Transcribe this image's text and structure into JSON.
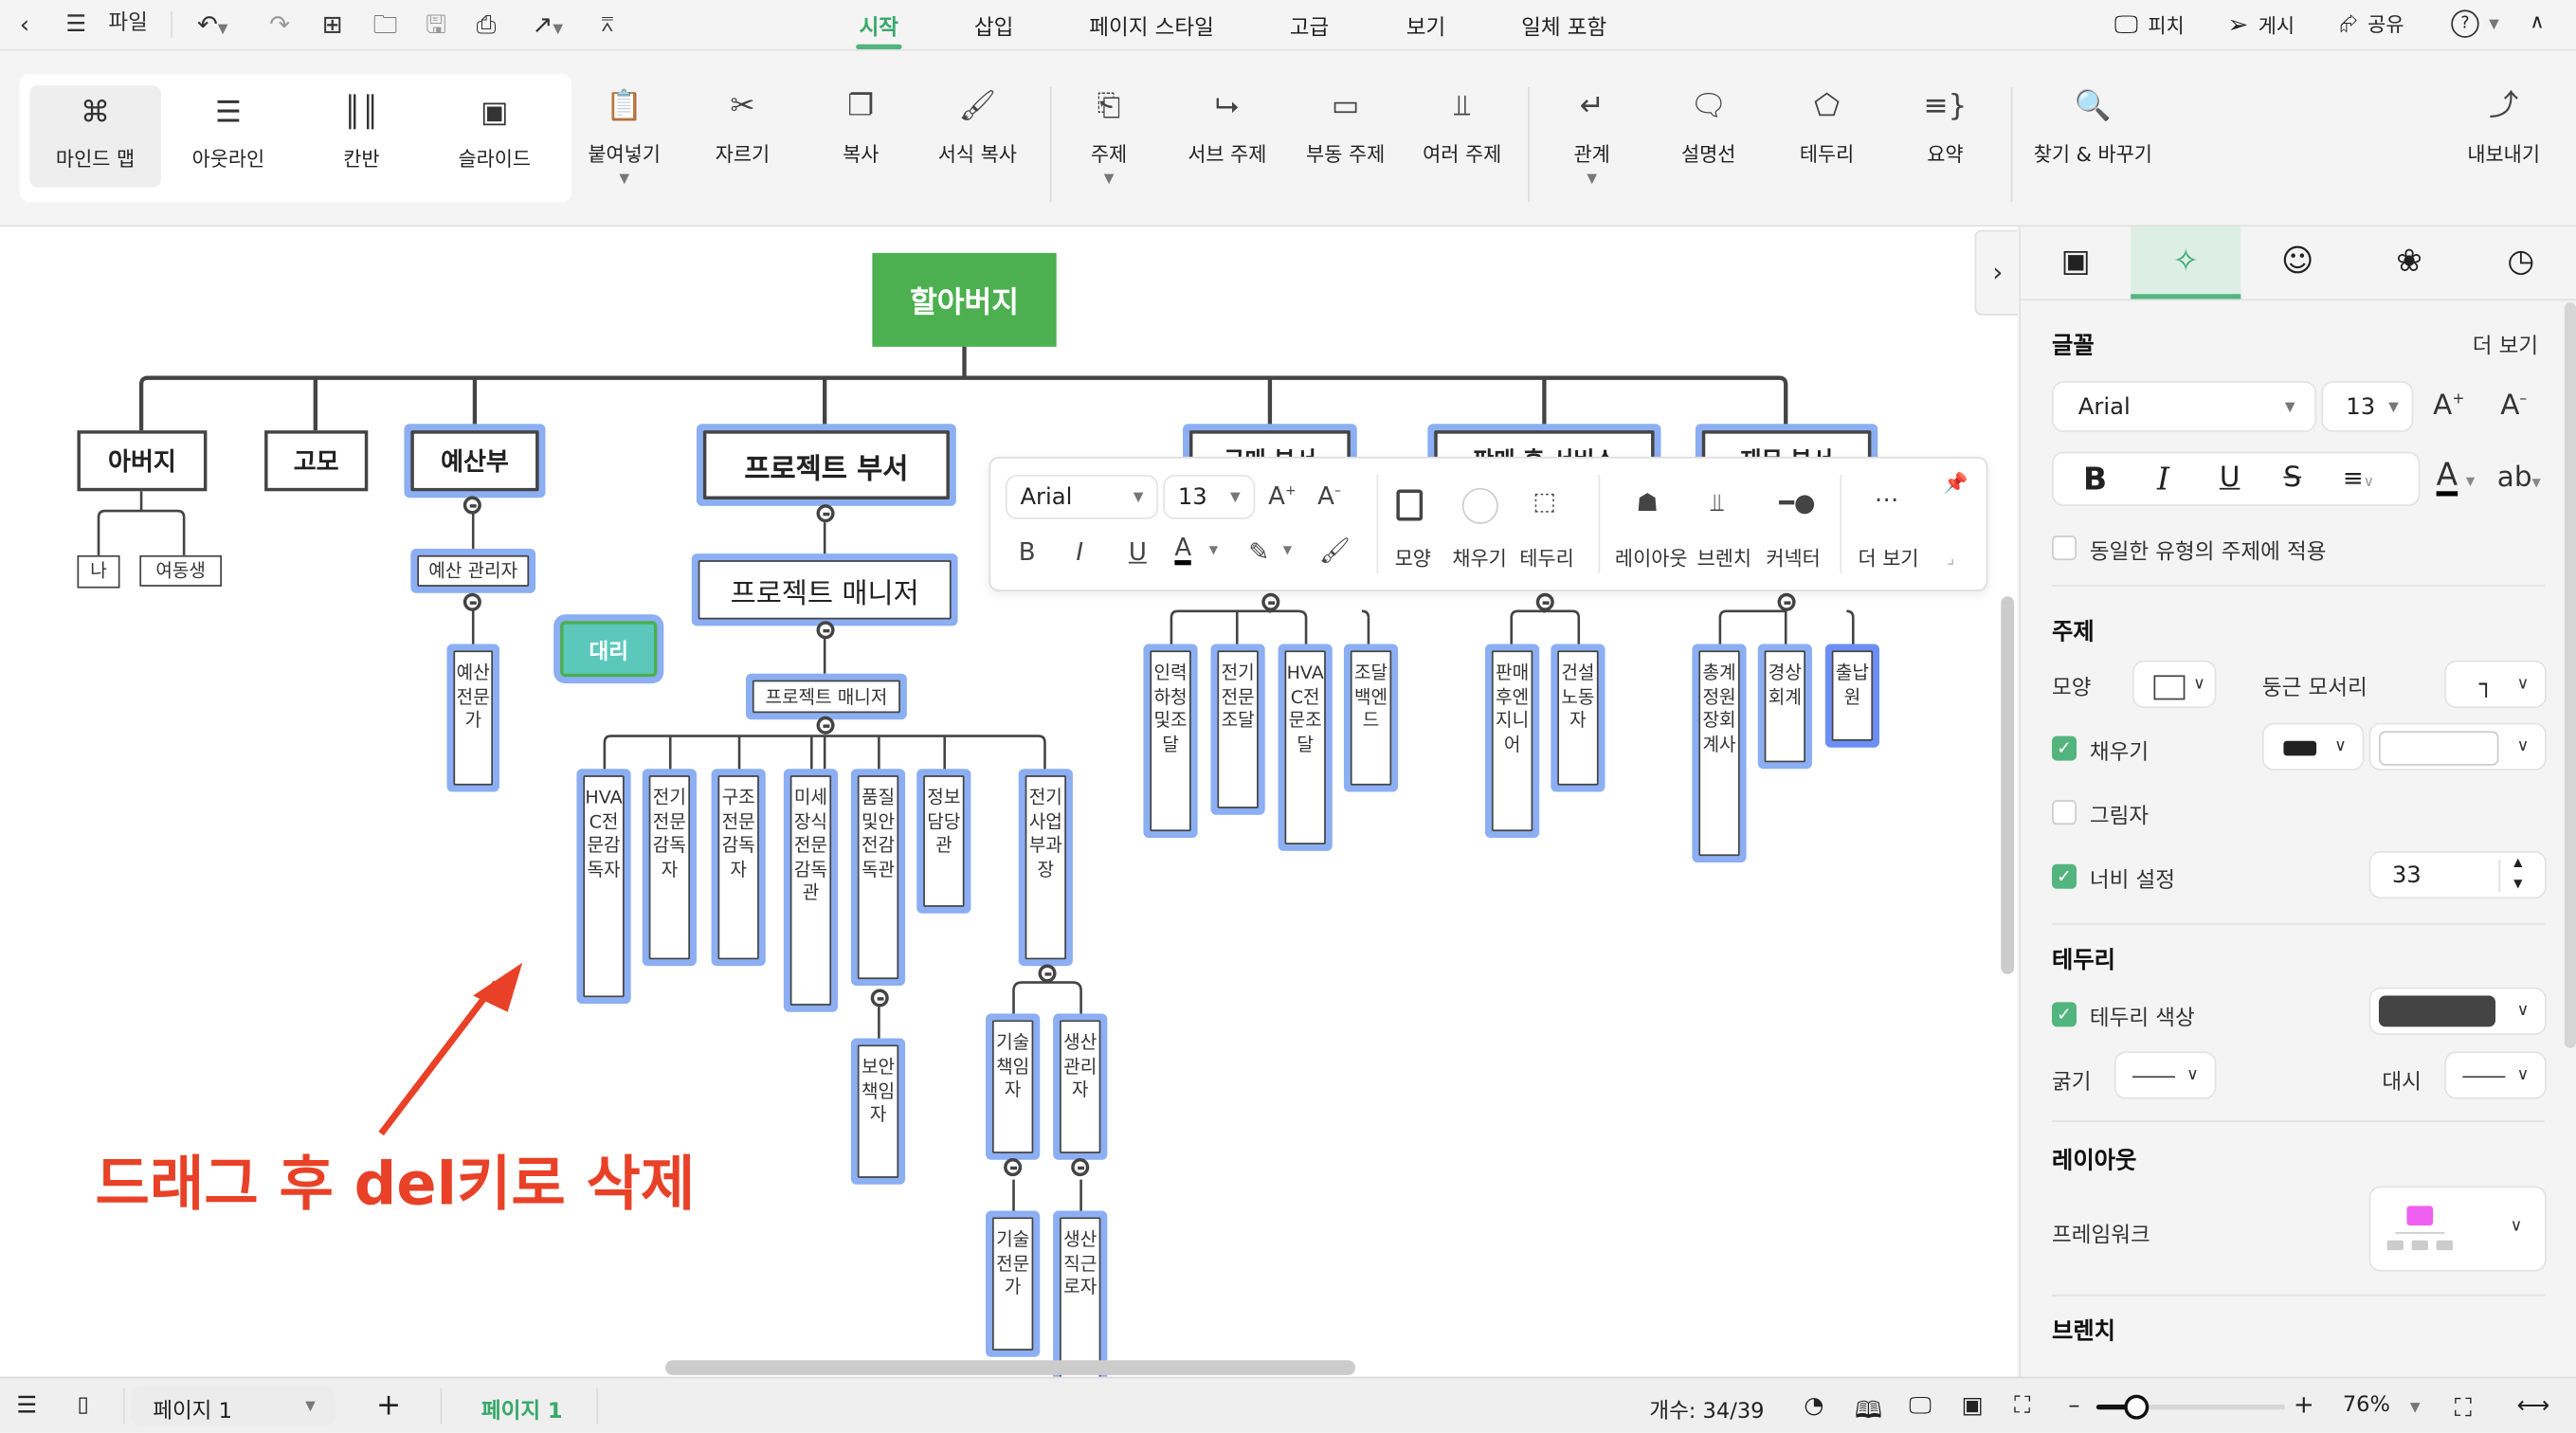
{
  "titlebar": {
    "back_icon": "chevron-left-icon",
    "menu_icon": "hamburger-icon",
    "file_label": "파일",
    "quick_icons": [
      "undo-icon",
      "redo-icon",
      "new-icon",
      "open-folder-icon",
      "save-icon",
      "print-icon",
      "export-icon",
      "customize-icon"
    ]
  },
  "menu_tabs": [
    {
      "label": "시작",
      "active": true
    },
    {
      "label": "삽입"
    },
    {
      "label": "페이지 스타일"
    },
    {
      "label": "고급"
    },
    {
      "label": "보기"
    },
    {
      "label": "일체 포함"
    }
  ],
  "top_right": {
    "pitch": "피치",
    "publish": "게시",
    "share": "공유"
  },
  "ribbon": {
    "views": [
      {
        "label": "마인드 맵",
        "icon": "mindmap-icon",
        "active": true
      },
      {
        "label": "아웃라인",
        "icon": "outline-icon"
      },
      {
        "label": "칸반",
        "icon": "kanban-icon"
      },
      {
        "label": "슬라이드",
        "icon": "slide-icon"
      }
    ],
    "buttons": [
      {
        "label": "붙여넣기",
        "icon": "paste-icon",
        "dropdown": true
      },
      {
        "label": "자르기",
        "icon": "cut-icon"
      },
      {
        "label": "복사",
        "icon": "copy-icon"
      },
      {
        "label": "서식 복사",
        "icon": "format-painter-icon"
      },
      {
        "label": "주제",
        "icon": "topic-icon",
        "dropdown": true
      },
      {
        "label": "서브 주제",
        "icon": "subtopic-icon"
      },
      {
        "label": "부동 주제",
        "icon": "floating-topic-icon"
      },
      {
        "label": "여러 주제",
        "icon": "multiple-topics-icon"
      },
      {
        "label": "관계",
        "icon": "relationship-icon",
        "dropdown": true
      },
      {
        "label": "설명선",
        "icon": "callout-icon"
      },
      {
        "label": "테두리",
        "icon": "boundary-icon"
      },
      {
        "label": "요약",
        "icon": "summary-icon"
      },
      {
        "label": "찾기 & 바꾸기",
        "icon": "find-replace-icon"
      },
      {
        "label": "내보내기",
        "icon": "export-icon"
      }
    ]
  },
  "mindmap": {
    "root": "할아버지",
    "level1": [
      "아버지",
      "고모",
      "예산부",
      "프로젝트 부서",
      "구매 부서",
      "판매 후 서비스",
      "재무 부서"
    ],
    "father_children": [
      "나",
      "여동생"
    ],
    "budget_children": [
      "예산 관리자",
      "예산전문가"
    ],
    "floating": "대리",
    "project": {
      "manager_big": "프로젝트 매니저",
      "manager_small": "프로젝트 매니저",
      "children": [
        "HVAC전문감독자",
        "전기전문감독자",
        "구조전문감독자",
        "미세장식전문감독관",
        "품질및안전감독관",
        "정보담당관",
        "전기사업부과장"
      ],
      "quality_child": "보안책임자",
      "electric_children": [
        "기술책임자",
        "생산관리자"
      ],
      "tech_child": "기술전문가",
      "prod_child": "생산직근로자"
    },
    "purchase_children": [
      "인력하청및조달",
      "전기전문조달",
      "HVAC전문조달",
      "조달백엔드"
    ],
    "aftersales_children": [
      "판매후엔지니어",
      "건설노동자"
    ],
    "finance_children": [
      "총계정원장회계사",
      "경상회계",
      "출납원"
    ],
    "annotation": "드래그 후 del키로 삭제"
  },
  "floating_toolbar": {
    "font": "Arial",
    "size": "13",
    "labels": {
      "shape": "모양",
      "fill": "채우기",
      "border": "테두리",
      "layout": "레이아웃",
      "branch": "브렌치",
      "connector": "커넥터",
      "more": "더 보기"
    }
  },
  "panel": {
    "tabs": [
      "style-icon",
      "ai-sparkle-icon",
      "marker-icon",
      "theme-icon",
      "clock-icon"
    ],
    "font_section": "글꼴",
    "more": "더 보기",
    "font": "Arial",
    "size": "13",
    "apply_same": "동일한 유형의 주제에 적용",
    "topic_section": "주제",
    "shape": "모양",
    "corner": "둥근 모서리",
    "fill": "채우기",
    "shadow": "그림자",
    "width_set": "너비 설정",
    "width_value": "33",
    "border_section": "테두리",
    "border_color": "테두리 색상",
    "thickness": "굵기",
    "dash": "대시",
    "layout_section": "레이아웃",
    "framework": "프레임워크",
    "branch_section": "브렌치",
    "colors": {
      "fill_swatch": "#222222",
      "border_swatch": "#444444",
      "accent": "#53b57d",
      "framework_root": "#f060f0"
    }
  },
  "statusbar": {
    "page_select": "페이지 1",
    "page_tab": "페이지 1",
    "count": "개수: 34/39",
    "zoom": "76%",
    "zoom_fraction": 0.2
  }
}
